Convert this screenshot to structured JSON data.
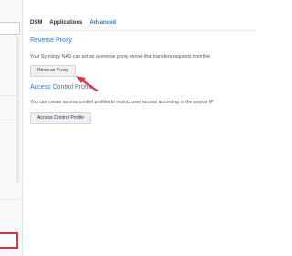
{
  "tabs": [
    {
      "label": "DSM",
      "active": false
    },
    {
      "label": "Applications",
      "active": false
    },
    {
      "label": "Advanced",
      "active": true
    }
  ],
  "reverse_proxy": {
    "title": "Reverse Proxy",
    "description": "Your Synology NAS can act as a reverse proxy server that transfers requests from the",
    "button_label": "Reverse Proxy"
  },
  "access_control": {
    "title": "Access Control Profile",
    "description": "You can create access control profiles to restrict user access according to the source IP",
    "button_label": "Access Control Profile"
  },
  "colors": {
    "accent": "#1e7bd6",
    "highlight": "#e0343a"
  },
  "annotation": {
    "arrow_icon": "red-arrow-pointing-to-reverse-proxy-button"
  }
}
